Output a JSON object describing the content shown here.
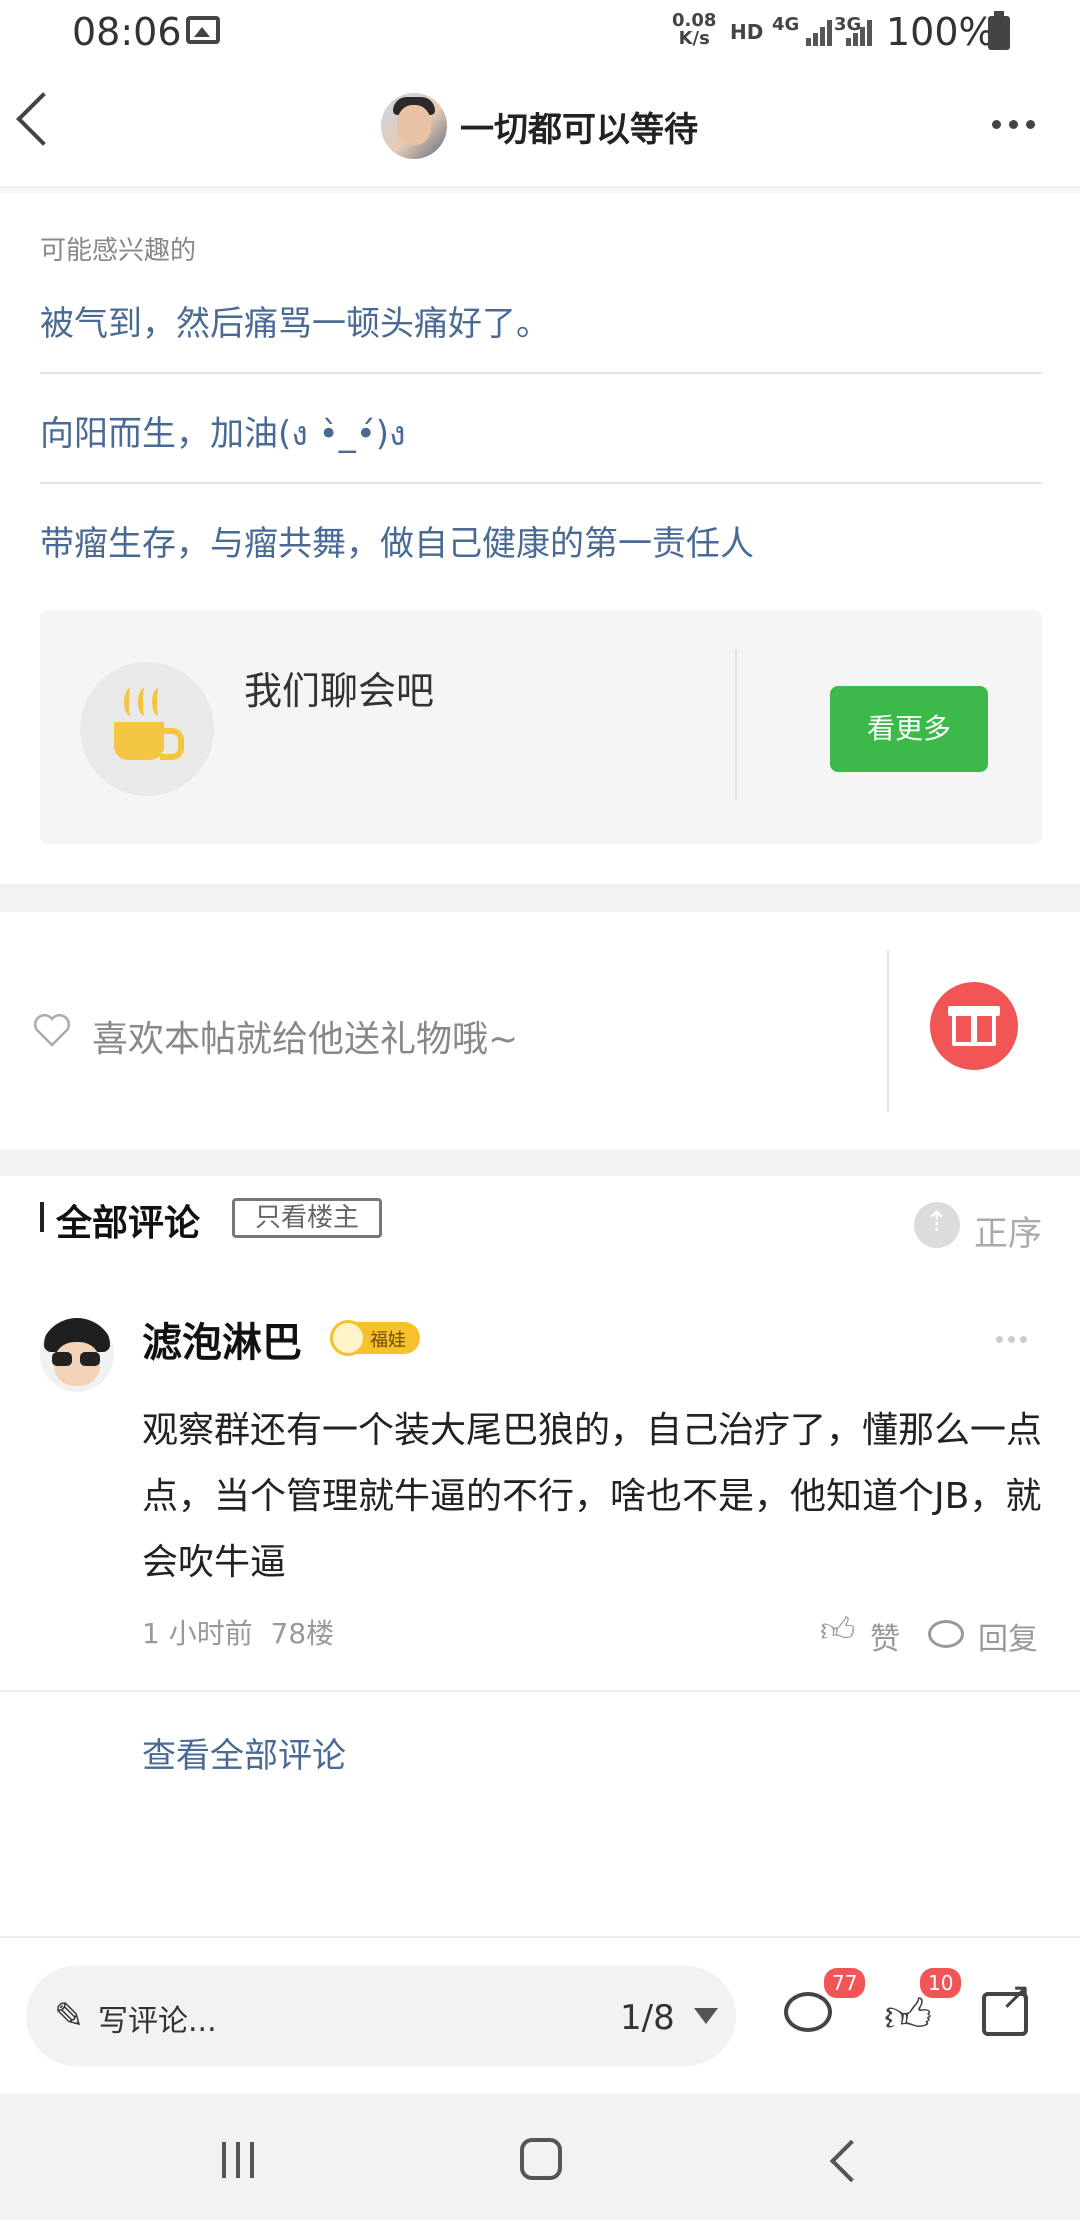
{
  "status_bar": {
    "time": "08:06",
    "net_speed_value": "0.08",
    "net_speed_unit": "K/s",
    "hd": "HD",
    "network_4g": "4G",
    "network_3g": "3G",
    "battery": "100%"
  },
  "header": {
    "title": "一切都可以等待"
  },
  "recommended": {
    "heading": "可能感兴趣的",
    "items": [
      {
        "text": "被气到，然后痛骂一顿头痛好了。"
      },
      {
        "text": "向阳而生，加油(ง •̀_•́)ง"
      },
      {
        "text": "带瘤生存，与瘤共舞，做自己健康的第一责任人"
      }
    ]
  },
  "chat_card": {
    "title": "我们聊会吧",
    "button": "看更多"
  },
  "gift": {
    "prompt": "喜欢本帖就给他送礼物哦~"
  },
  "comments": {
    "title": "全部评论",
    "filter_owner": "只看楼主",
    "sort": "正序",
    "items": [
      {
        "username": "滤泡淋巴",
        "badge": "福娃",
        "text": "观察群还有一个装大尾巴狼的，自己治疗了，懂那么一点点，当个管理就牛逼的不行，啥也不是，他知道个JB，就会吹牛逼",
        "time": "1 小时前",
        "floor": "78楼",
        "like_label": "赞",
        "reply_label": "回复"
      }
    ],
    "view_all": "查看全部评论"
  },
  "bottom_bar": {
    "write_placeholder": "写评论...",
    "page": "1/8",
    "comment_count": "77",
    "like_count": "10"
  },
  "colors": {
    "accent_link": "#4a6a96",
    "button_green": "#3cb94a",
    "gift_red": "#f25555",
    "badge_yellow": "#f6c12a"
  },
  "icons": [
    "back-arrow-icon",
    "more-icon",
    "coffee-cup-icon",
    "heart-icon",
    "gift-icon",
    "sort-icon",
    "like-icon",
    "reply-icon",
    "pencil-icon",
    "comment-icon",
    "share-icon"
  ]
}
